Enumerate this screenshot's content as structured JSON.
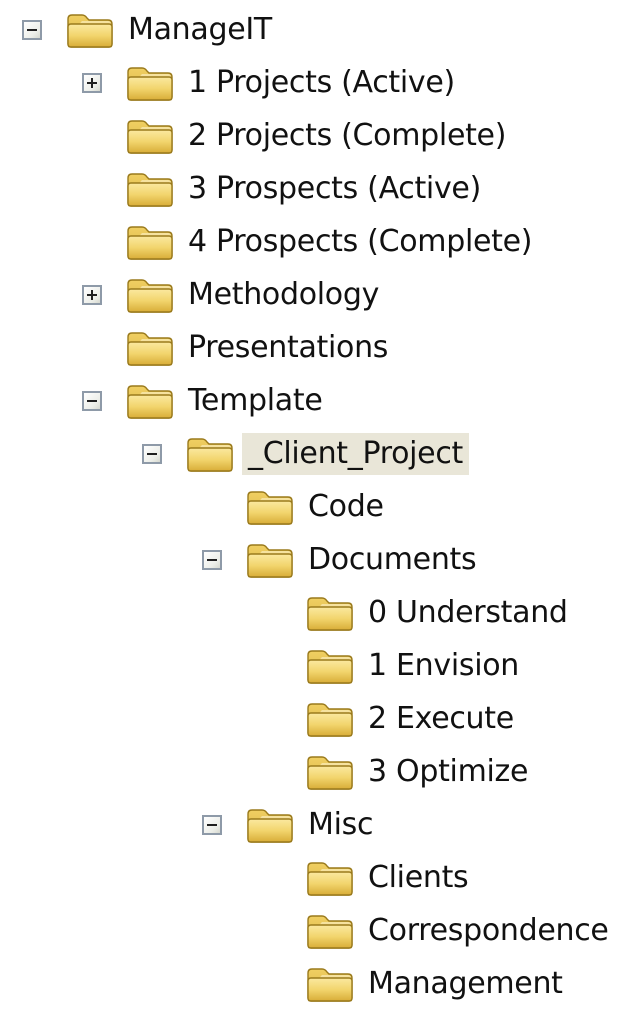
{
  "tree": {
    "items": [
      {
        "label": "ManageIT",
        "toggle": "minus",
        "level": 0,
        "selected": false
      },
      {
        "label": "1 Projects (Active)",
        "toggle": "plus",
        "level": 1,
        "selected": false
      },
      {
        "label": "2 Projects (Complete)",
        "toggle": "none",
        "level": 1,
        "selected": false
      },
      {
        "label": "3 Prospects (Active)",
        "toggle": "none",
        "level": 1,
        "selected": false
      },
      {
        "label": "4 Prospects (Complete)",
        "toggle": "none",
        "level": 1,
        "selected": false
      },
      {
        "label": "Methodology",
        "toggle": "plus",
        "level": 1,
        "selected": false
      },
      {
        "label": "Presentations",
        "toggle": "none",
        "level": 1,
        "selected": false
      },
      {
        "label": "Template",
        "toggle": "minus",
        "level": 1,
        "selected": false
      },
      {
        "label": "_Client_Project",
        "toggle": "minus",
        "level": 2,
        "selected": true
      },
      {
        "label": "Code",
        "toggle": "none",
        "level": 3,
        "selected": false
      },
      {
        "label": "Documents",
        "toggle": "minus",
        "level": 3,
        "selected": false
      },
      {
        "label": "0 Understand",
        "toggle": "none",
        "level": 4,
        "selected": false
      },
      {
        "label": "1 Envision",
        "toggle": "none",
        "level": 4,
        "selected": false
      },
      {
        "label": "2 Execute",
        "toggle": "none",
        "level": 4,
        "selected": false
      },
      {
        "label": "3 Optimize",
        "toggle": "none",
        "level": 4,
        "selected": false
      },
      {
        "label": "Misc",
        "toggle": "minus",
        "level": 3,
        "selected": false
      },
      {
        "label": "Clients",
        "toggle": "none",
        "level": 4,
        "selected": false
      },
      {
        "label": "Correspondence",
        "toggle": "none",
        "level": 4,
        "selected": false
      },
      {
        "label": "Management",
        "toggle": "none",
        "level": 4,
        "selected": false
      }
    ]
  },
  "colors": {
    "folder_front": "#f2d56e",
    "folder_back": "#d9b548",
    "folder_outline": "#9a7a1c",
    "selection_bg": "#e9e6d8",
    "toggle_border": "#8e9aa8"
  },
  "icons": {
    "folder": "folder-icon",
    "expand": "plus-icon",
    "collapse": "minus-icon"
  }
}
